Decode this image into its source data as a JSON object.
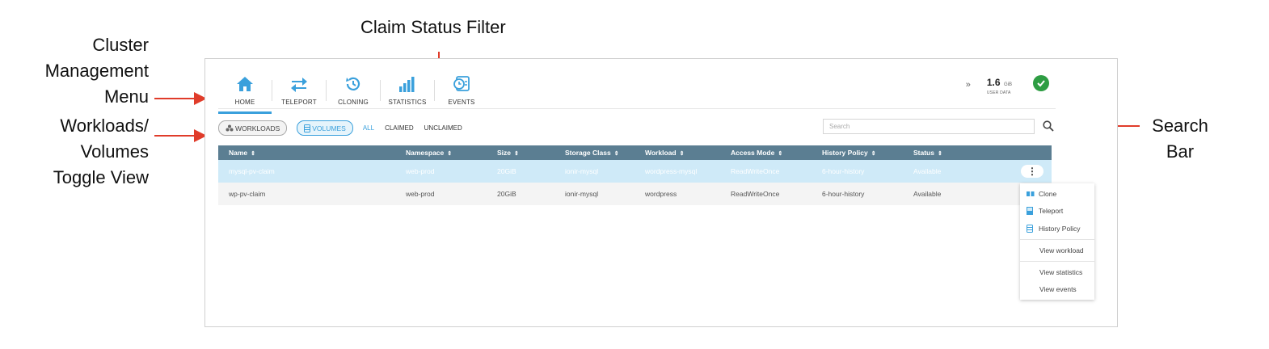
{
  "annotations": {
    "cluster_menu": [
      "Cluster",
      "Management",
      "Menu"
    ],
    "claim_filter": "Claim Status Filter",
    "toggle_view": [
      "Workloads/",
      "Volumes",
      "Toggle View"
    ],
    "search_bar": [
      "Search",
      "Bar"
    ]
  },
  "nav": {
    "items": [
      {
        "label": "HOME",
        "icon": "home-icon"
      },
      {
        "label": "TELEPORT",
        "icon": "teleport-arrows-icon"
      },
      {
        "label": "CLONING",
        "icon": "cloning-clock-icon"
      },
      {
        "label": "STATISTICS",
        "icon": "statistics-bars-icon"
      },
      {
        "label": "EVENTS",
        "icon": "events-icon"
      }
    ],
    "active": "HOME"
  },
  "status": {
    "usage_value": "1.6",
    "usage_unit": "GiB",
    "usage_caption": "USER DATA",
    "health_icon": "check-circle-icon",
    "health_color": "#2e9d43"
  },
  "filters": {
    "workloads_label": "WORKLOADS",
    "volumes_label": "VOLUMES",
    "all_label": "ALL",
    "claimed_label": "CLAIMED",
    "unclaimed_label": "UNCLAIMED",
    "active_filter": "ALL"
  },
  "search": {
    "placeholder": "Search"
  },
  "table": {
    "headers": [
      "Name",
      "Namespace",
      "Size",
      "Storage Class",
      "Workload",
      "Access Mode",
      "History Policy",
      "Status"
    ],
    "rows": [
      [
        "mysql-pv-claim",
        "web-prod",
        "20GiB",
        "ionir-mysql",
        "wordpress-mysql",
        "ReadWriteOnce",
        "6-hour-history",
        "Available"
      ],
      [
        "wp-pv-claim",
        "web-prod",
        "20GiB",
        "ionir-mysql",
        "wordpress",
        "ReadWriteOnce",
        "6-hour-history",
        "Available"
      ]
    ],
    "header_color": "#5b7e92",
    "selected_row_color": "#cfeaf8"
  },
  "row_menu": {
    "clone": "Clone",
    "teleport": "Teleport",
    "history_policy": "History Policy",
    "view_workload": "View workload",
    "view_statistics": "View statistics",
    "view_events": "View events"
  },
  "colors": {
    "accent": "#3aa0dc",
    "annotation_arrow": "#e03c2a"
  }
}
